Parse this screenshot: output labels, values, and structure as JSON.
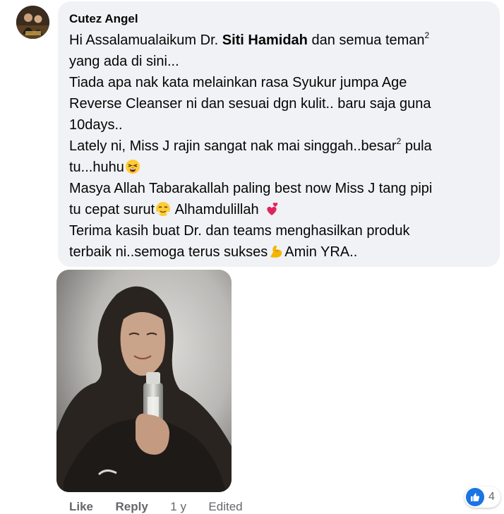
{
  "comment": {
    "author": "Cutez Angel",
    "body": {
      "l1a": "Hi Assalamualaikum Dr. ",
      "l1b": "Siti Hamidah",
      "l1c": " dan semua teman",
      "l1sup": "2",
      "l2": "yang ada di sini...",
      "l3": "Tiada apa nak kata melainkan rasa Syukur jumpa Age",
      "l4": "Reverse Cleanser ni dan sesuai dgn kulit.. baru saja guna",
      "l5": "10days..",
      "l6a": "Lately ni, Miss J rajin sangat nak mai singgah..besar",
      "l6sup": "2",
      "l6b": " pula",
      "l7": "tu...huhu",
      "l8": "Masya Allah Tabarakallah paling best now Miss J tang pipi",
      "l9a": "tu cepat surut",
      "l9b": " Alhamdulillah ",
      "l10": "Terima kasih buat Dr. dan teams menghasilkan produk",
      "l11a": "terbaik ni..semoga terus sukses",
      "l11b": "Amin YRA.."
    },
    "emojis": [
      "tired-face",
      "face-with-steam",
      "two-hearts",
      "flexed-biceps"
    ],
    "actions": {
      "like": "Like",
      "reply": "Reply",
      "time": "1 y",
      "edited": "Edited"
    },
    "reactions": {
      "type": "like-icon",
      "count": "4",
      "color": "#1b74e4"
    }
  },
  "colors": {
    "bubble": "#f0f2f5",
    "text": "#050505",
    "secondary": "#65676b",
    "accent": "#1b74e4"
  }
}
